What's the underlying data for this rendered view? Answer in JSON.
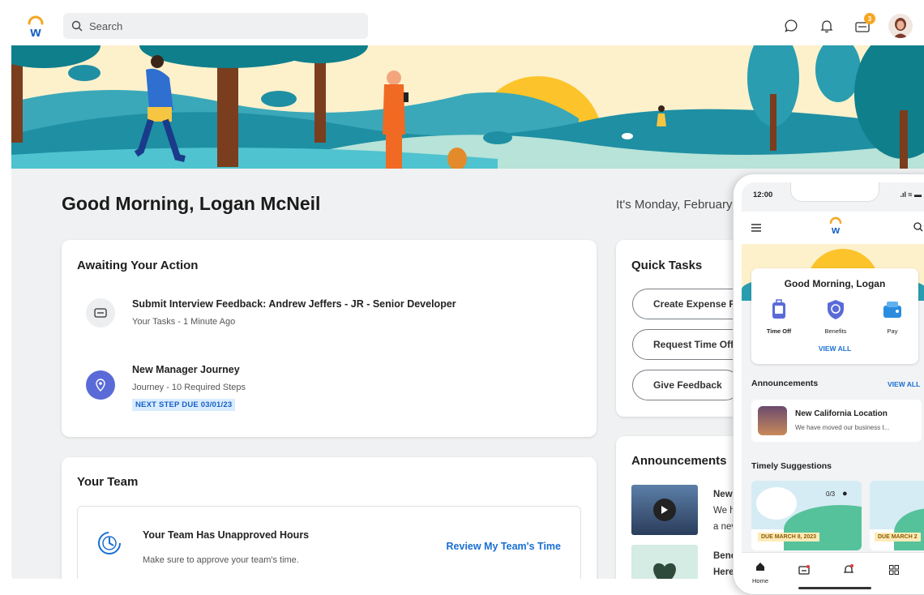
{
  "search": {
    "placeholder": "Search"
  },
  "topbar": {
    "notification_count": "3"
  },
  "greeting": "Good Morning, Logan McNeil",
  "date_text": "It's Monday, February",
  "awaiting": {
    "title": "Awaiting Your Action",
    "items": [
      {
        "title": "Submit Interview Feedback: Andrew Jeffers - JR - Senior Developer",
        "sub": "Your Tasks - 1 Minute Ago",
        "icon": "inbox-icon"
      },
      {
        "title": "New Manager Journey",
        "sub": "Journey - 10 Required Steps",
        "tag": "NEXT STEP DUE 03/01/23",
        "icon": "location-pin-icon"
      }
    ]
  },
  "quick_tasks": {
    "title": "Quick Tasks",
    "buttons": [
      "Create Expense Re",
      "Request Time Off",
      "Give Feedback"
    ]
  },
  "team": {
    "title": "Your Team",
    "card_title": "Your Team Has Unapproved Hours",
    "card_sub": "Make sure to approve your team's time.",
    "link": "Review My Team's Time"
  },
  "announcements": {
    "title": "Announcements",
    "items": [
      {
        "lines": [
          "New",
          "We h",
          "a nev"
        ]
      },
      {
        "lines": [
          "Bene",
          "Here"
        ]
      }
    ]
  },
  "phone": {
    "time": "12:00",
    "greeting": "Good Morning, Logan",
    "apps": [
      {
        "label": "Time Off",
        "icon": "suitcase-icon"
      },
      {
        "label": "Benefits",
        "icon": "shield-icon"
      },
      {
        "label": "Pay",
        "icon": "wallet-icon"
      }
    ],
    "view_all": "VIEW ALL",
    "announcements_title": "Announcements",
    "announcements_view_all": "VIEW ALL",
    "announcement": {
      "title": "New California Location",
      "sub": "We have moved our business t..."
    },
    "suggestions_title": "Timely Suggestions",
    "suggestions": [
      {
        "count": "0/3",
        "due": "DUE MARCH 8, 2023"
      },
      {
        "due": "DUE MARCH 2"
      }
    ],
    "nav": [
      {
        "label": "Home",
        "icon": "home-icon"
      },
      {
        "icon": "inbox-icon"
      },
      {
        "icon": "bell-icon"
      },
      {
        "icon": "apps-grid-icon"
      }
    ]
  },
  "colors": {
    "accent": "#1a6fd3",
    "brand_orange": "#f5a623",
    "teal": "#2a9db0",
    "purple": "#5a6bd8"
  }
}
